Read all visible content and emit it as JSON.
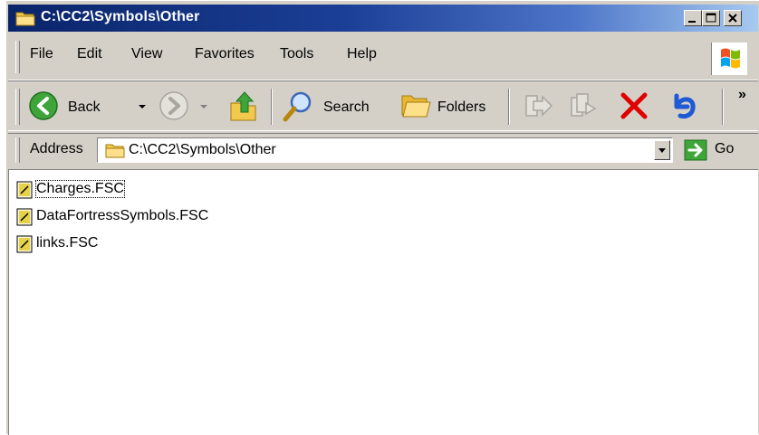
{
  "window": {
    "title": "C:\\CC2\\Symbols\\Other",
    "controls": [
      "minimize",
      "maximize",
      "close"
    ]
  },
  "menubar": {
    "items": [
      {
        "label": "File"
      },
      {
        "label": "Edit"
      },
      {
        "label": "View"
      },
      {
        "label": "Favorites"
      },
      {
        "label": "Tools"
      },
      {
        "label": "Help"
      }
    ]
  },
  "toolbar": {
    "back_label": "Back",
    "search_label": "Search",
    "folders_label": "Folders",
    "overflow_label": "»"
  },
  "address": {
    "label": "Address",
    "value": "C:\\CC2\\Symbols\\Other",
    "go_label": "Go"
  },
  "files": [
    {
      "name": "Charges.FSC",
      "focused": true
    },
    {
      "name": "DataFortressSymbols.FSC",
      "focused": false
    },
    {
      "name": "links.FSC",
      "focused": false
    }
  ],
  "colors": {
    "titlebar_start": "#0a246a",
    "titlebar_end": "#a6caf0",
    "face": "#d4d0c8",
    "delete_red": "#e00000",
    "undo_blue": "#1e5ad6",
    "nav_green": "#3fa53a"
  }
}
